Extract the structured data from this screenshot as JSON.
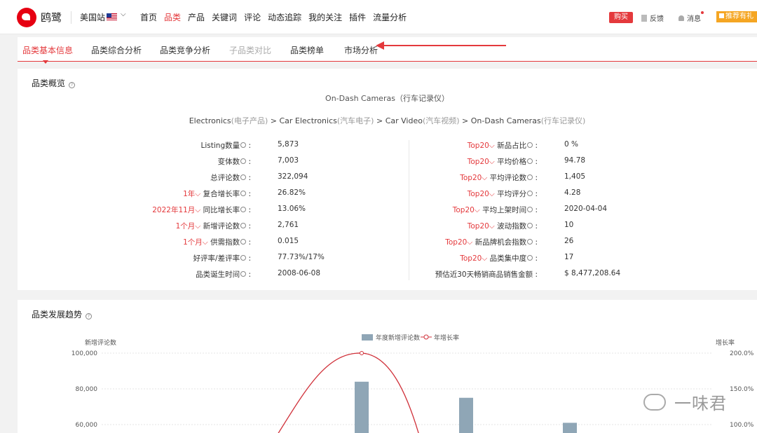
{
  "nav": {
    "brand": "鸥鹭",
    "site": "美国站",
    "items": [
      "首页",
      "品类",
      "产品",
      "关键词",
      "评论",
      "动态追踪",
      "我的关注",
      "插件",
      "流量分析"
    ],
    "active_index": 1,
    "buy": "购买",
    "feedback": "反馈",
    "messages": "消息",
    "recommend": "推荐有礼"
  },
  "tabs": [
    "品类基本信息",
    "品类综合分析",
    "品类竞争分析",
    "子品类对比",
    "品类榜单",
    "市场分析"
  ],
  "overview": {
    "title": "品类概览",
    "category": "On-Dash Cameras（行车记录仪）",
    "breadcrumb": [
      {
        "en": "Electronics",
        "zh": "(电子产品)"
      },
      {
        "en": "Car Electronics",
        "zh": "(汽车电子)"
      },
      {
        "en": "Car Video",
        "zh": "(汽车视频)"
      },
      {
        "en": "On-Dash Cameras",
        "zh": "(行车记录仪)"
      }
    ],
    "left": [
      {
        "prefix": "",
        "label": "Listing数量",
        "value": "5,873"
      },
      {
        "prefix": "",
        "label": "变体数",
        "value": "7,003"
      },
      {
        "prefix": "",
        "label": "总评论数",
        "value": "322,094"
      },
      {
        "prefix": "1年",
        "label": "复合增长率",
        "value": "26.82%"
      },
      {
        "prefix": "2022年11月",
        "label": "同比增长率",
        "value": "13.06%"
      },
      {
        "prefix": "1个月",
        "label": "新增评论数",
        "value": "2,761"
      },
      {
        "prefix": "1个月",
        "label": "供需指数",
        "value": "0.015"
      },
      {
        "prefix": "",
        "label": "好评率/差评率",
        "value": "77.73%/17%"
      },
      {
        "prefix": "",
        "label": "品类诞生时间",
        "value": "2008-06-08"
      }
    ],
    "right": [
      {
        "prefix": "Top20",
        "label": "新品占比",
        "value": "0 %"
      },
      {
        "prefix": "Top20",
        "label": "平均价格",
        "value": "94.78"
      },
      {
        "prefix": "Top20",
        "label": "平均评论数",
        "value": "1,405"
      },
      {
        "prefix": "Top20",
        "label": "平均评分",
        "value": "4.28"
      },
      {
        "prefix": "Top20",
        "label": "平均上架时间",
        "value": "2020-04-04"
      },
      {
        "prefix": "Top20",
        "label": "波动指数",
        "value": "10"
      },
      {
        "prefix": "Top20",
        "label": "新品牌机会指数",
        "value": "26"
      },
      {
        "prefix": "Top20",
        "label": "品类集中度",
        "value": "17"
      },
      {
        "prefix": "",
        "label": "预估近30天畅销商品销售金额",
        "value": "$ 8,477,208.64"
      }
    ]
  },
  "trend": {
    "title": "品类发展趋势",
    "legend_bar": "年度新增评论数",
    "legend_line": "年增长率",
    "y_left_label": "新增评论数",
    "y_right_label": "增长率",
    "y_left_ticks": [
      "100,000",
      "80,000",
      "60,000"
    ],
    "y_right_ticks": [
      "200.0%",
      "150.0%",
      "100.0%"
    ],
    "bar_color": "#8fa6b6",
    "line_color": "#d0313a"
  },
  "chart_data": {
    "type": "bar",
    "series": [
      {
        "name": "年度新增评论数",
        "values": [
          84000,
          75000,
          61000
        ]
      },
      {
        "name": "年增长率",
        "values": [
          200.0
        ]
      }
    ],
    "y_left_range": [
      60000,
      100000
    ],
    "y_right_range": [
      100,
      200
    ]
  },
  "watermark": "一味君"
}
